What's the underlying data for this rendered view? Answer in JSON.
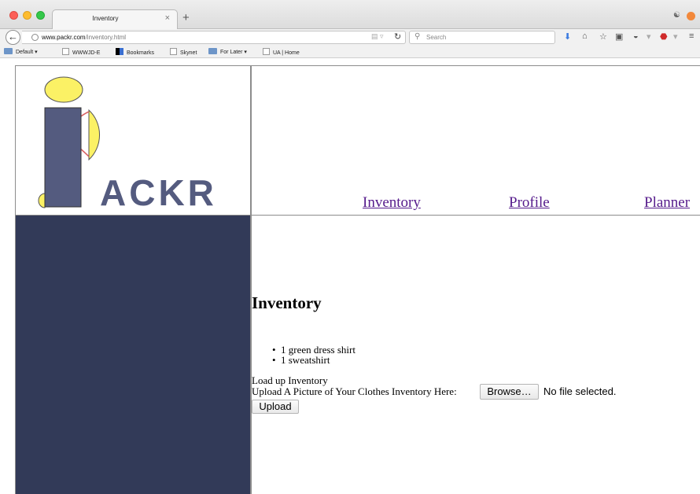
{
  "browser": {
    "tab_title": "Inventory",
    "tab_close": "×",
    "new_tab": "+",
    "url_domain": "www.packr.com",
    "url_path": "/inventory.html",
    "search_placeholder": "Search",
    "bookmarks": [
      {
        "label": "Default ▾",
        "icon": "folder-icon"
      },
      {
        "label": "WWWJD-E",
        "icon": "page-icon"
      },
      {
        "label": "Bookmarks",
        "icon": "bookmarks-icon"
      },
      {
        "label": "Skynet",
        "icon": "page-icon"
      },
      {
        "label": "For Later ▾",
        "icon": "folder-icon"
      },
      {
        "label": "UA | Home",
        "icon": "page-icon"
      }
    ]
  },
  "site": {
    "logo_text": "ACKR",
    "nav": {
      "inventory": "Inventory",
      "profile": "Profile",
      "planner": "Planner"
    },
    "colors": {
      "sidebar": "#323a58",
      "logo_yellow": "#fbf165",
      "logo_navy": "#545b7f",
      "link": "#551a8b"
    }
  },
  "main": {
    "title": "Inventory",
    "items": [
      "1 green dress shirt",
      "1 sweatshirt"
    ],
    "form_heading": "Load up Inventory",
    "upload_label": "Upload A Picture of Your Clothes Inventory Here:",
    "browse_label": "Browse…",
    "no_file_text": "No file selected.",
    "upload_button": "Upload"
  }
}
